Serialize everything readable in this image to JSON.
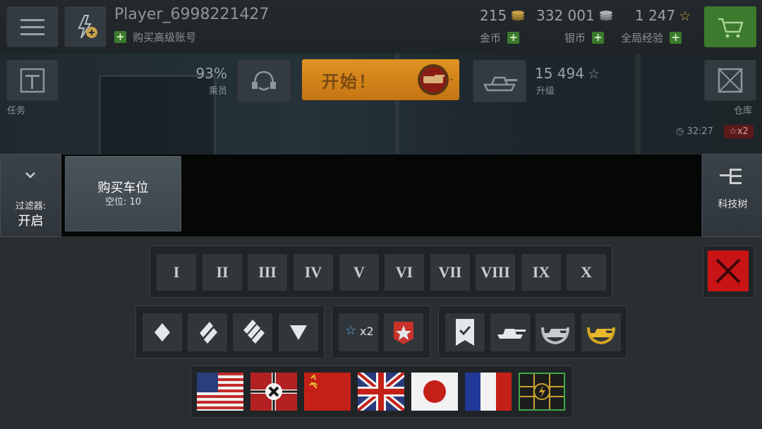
{
  "player": {
    "name": "Player_6998221427",
    "premium_label": "购买高级账号"
  },
  "currency": {
    "gold": {
      "value": "215",
      "label": "金币"
    },
    "silver": {
      "value": "332 001",
      "label": "银币"
    },
    "xp": {
      "value": "1 247",
      "label": "全局经验"
    }
  },
  "garage": {
    "missions_label": "任务",
    "crew_percent": "93%",
    "crew_label": "乘员",
    "battle_label": "开始！",
    "upgrade_value": "15 494",
    "upgrade_label": "升级",
    "depot_label": "仓库",
    "timer": "32:27",
    "xp_multiplier": "x2"
  },
  "filter": {
    "label": "过滤器:",
    "state": "开启"
  },
  "buy_slot": {
    "title": "购买车位",
    "sub": "空位: 10"
  },
  "tech_tree_label": "科技树",
  "tiers": [
    "I",
    "II",
    "III",
    "IV",
    "V",
    "VI",
    "VII",
    "VIII",
    "IX",
    "X"
  ],
  "bonus": {
    "star_x2": "x2"
  },
  "icons": [
    "menu-icon",
    "boost-icon",
    "gold-coin-icon",
    "silver-coin-icon",
    "star-icon",
    "cart-icon",
    "missions-icon",
    "crew-icon",
    "tank-icon",
    "depot-icon",
    "tech-tree-icon",
    "close-icon"
  ],
  "nations": [
    "usa",
    "germany",
    "ussr",
    "uk",
    "japan",
    "france",
    "european"
  ],
  "colors": {
    "gold": "#c9a24a",
    "green": "#3f7f2c",
    "battle_orange": "#d98a1e",
    "close_red": "#c81414"
  }
}
